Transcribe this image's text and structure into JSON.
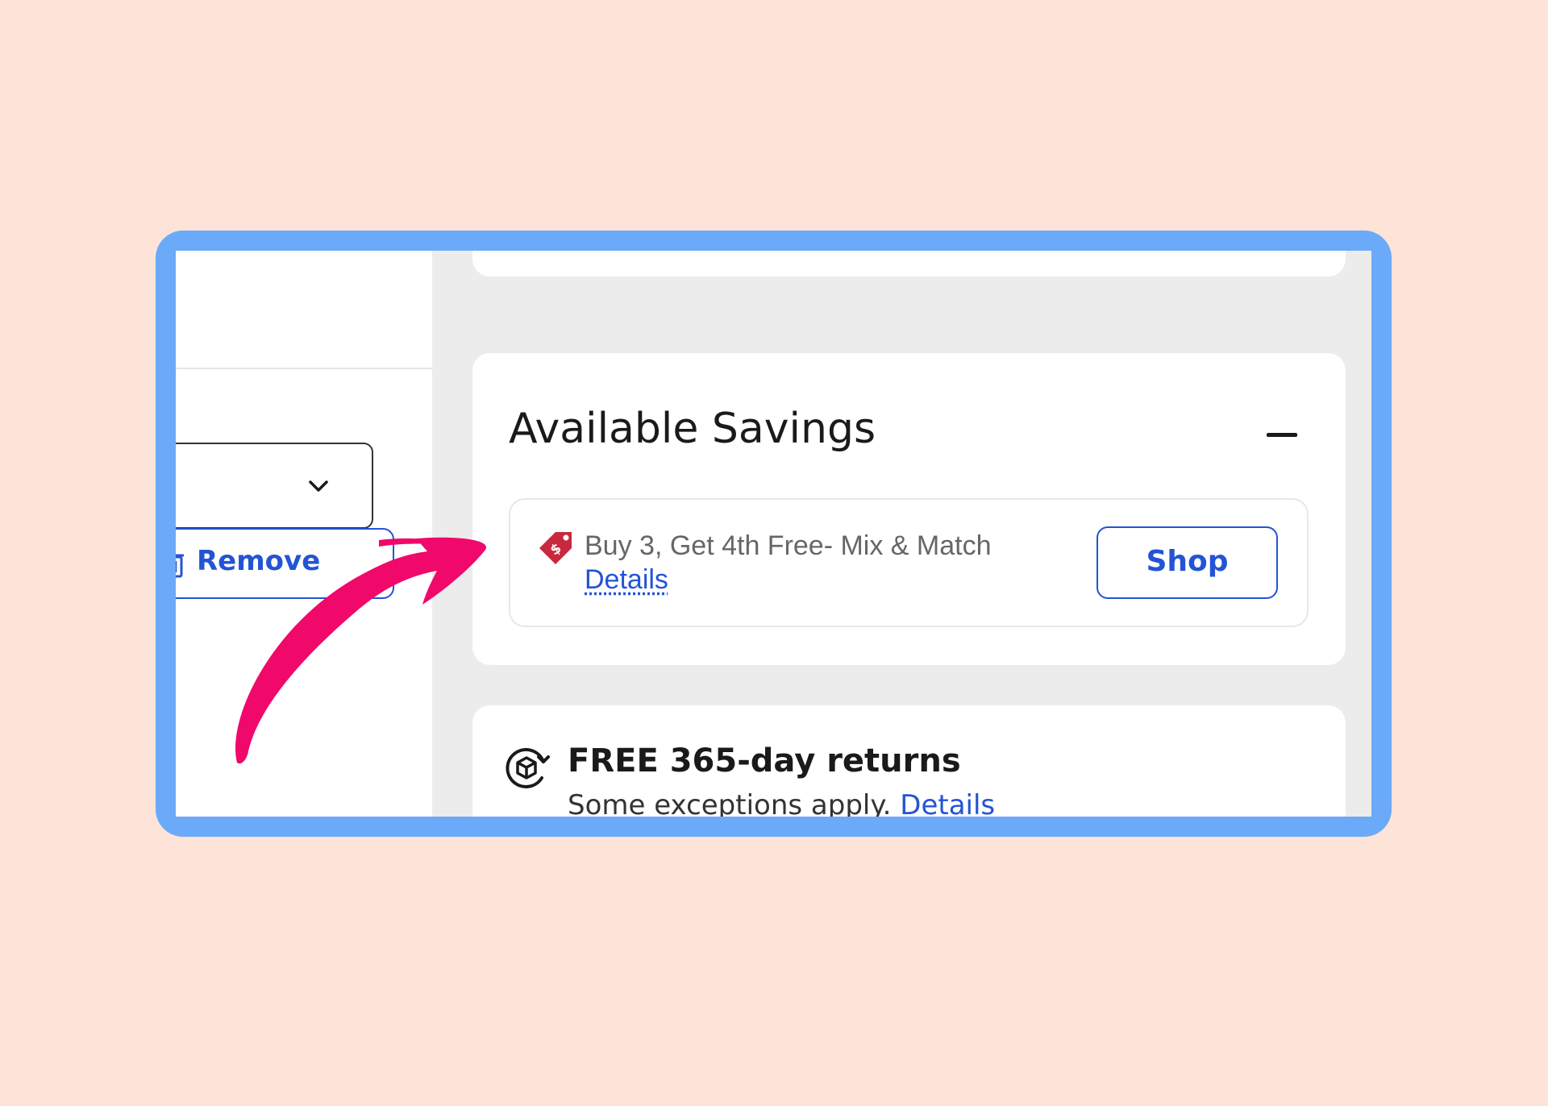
{
  "colors": {
    "background": "#fee3d8",
    "frame": "#6aaaf9",
    "panel_gray": "#ececec",
    "link_blue": "#2354d4",
    "tag_red": "#c8293e",
    "arrow_pink": "#f0086a"
  },
  "cart_item": {
    "quantity_select_icon": "chevron-down-icon",
    "remove_icon": "trash-icon",
    "remove_label": "Remove"
  },
  "savings": {
    "title": "Available Savings",
    "collapse_icon": "minus-icon",
    "offer": {
      "icon": "price-tag-icon",
      "text": "Buy 3, Get 4th Free- Mix & Match",
      "details_label": "Details",
      "shop_label": "Shop"
    }
  },
  "returns": {
    "icon": "returns-box-icon",
    "title": "FREE 365-day returns",
    "subtitle": "Some exceptions apply.",
    "details_label": "Details"
  },
  "annotation": {
    "icon": "curved-arrow-icon"
  }
}
